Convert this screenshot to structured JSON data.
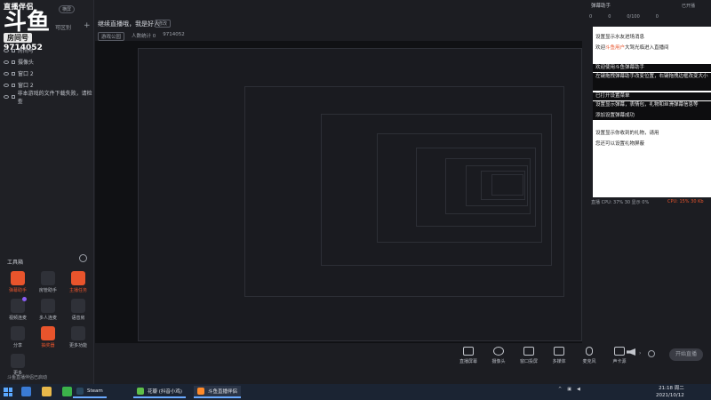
{
  "logo": {
    "line1": "直播伴侣",
    "line2": "斗鱼",
    "badge": "房间号",
    "room_id": "9714052"
  },
  "left": {
    "scene_label": "可区别",
    "add_label": "+",
    "sources": [
      {
        "label": "房间号"
      },
      {
        "label": "摄像头"
      },
      {
        "label": "窗口 2"
      },
      {
        "label": "窗口 2"
      },
      {
        "label": "非本游戏的文件下载失败，请检查"
      }
    ],
    "toolbox_title": "工具箱",
    "tools": [
      {
        "label": "弹幕助手",
        "red": true
      },
      {
        "label": "房管助手",
        "red": false
      },
      {
        "label": "主播任务",
        "red": true
      },
      {
        "label": "视频连麦",
        "red": false
      },
      {
        "label": "多人连麦",
        "red": false
      },
      {
        "label": "语音房",
        "red": false
      },
      {
        "label": "分享",
        "red": false
      },
      {
        "label": "抽奖器",
        "red": true
      },
      {
        "label": "更多功能",
        "red": false
      },
      {
        "label": "更多",
        "red": false
      }
    ]
  },
  "header": {
    "mode": "横屏",
    "announcement": "继续直播哦，我是好人",
    "edit": "修改",
    "category": "游戏公园",
    "fans": "人数统计 0",
    "room": "9714052"
  },
  "bottombar": {
    "items": [
      {
        "label": "直播屏幕"
      },
      {
        "label": "摄像头"
      },
      {
        "label": "窗口投屏"
      },
      {
        "label": "多媒体"
      },
      {
        "label": "麦克风"
      },
      {
        "label": "声卡源"
      }
    ],
    "live_button": "开始直播"
  },
  "right": {
    "title": "弹幕助手",
    "corner": "已开播",
    "stats": [
      "0",
      "0",
      "0/100",
      "0"
    ],
    "messages": [
      {
        "text": "设置显示水友进场消息",
        "dark": false
      },
      {
        "text": "欢迎",
        "red": "斗鱼用户",
        "rest": "大驾光临进入直播间",
        "dark": false
      },
      {
        "text": "欢迎使用斗鱼弹幕助手",
        "dark": true
      },
      {
        "text": "左键拖拽弹幕助手改变位置，右键拖拽边框改变大小",
        "dark": true
      },
      {
        "text": "已打开设置菜单",
        "dark": true
      },
      {
        "text": "设置显示弹幕，表情包，礼物和丝滑弹幕信息等",
        "dark": true
      },
      {
        "text": "添加设置弹幕成功",
        "dark": true
      },
      {
        "text": "设置显示你收到的礼物，请用",
        "dark": false
      },
      {
        "text": "您还可以设置礼物屏蔽",
        "dark": false
      }
    ],
    "footer_stats": "直播 CPU: 37% 30 显示 0%",
    "footer_cpu": "CPU: 15% 30 Kb"
  },
  "taskbar": {
    "apps": [
      {
        "label": "Steam",
        "color": "#2a475e"
      },
      {
        "label": "花瓣 (抖音小鸡)",
        "color": "#5fbf4a"
      },
      {
        "label": "斗鱼直播伴侣",
        "color": "#ff8a2a"
      }
    ],
    "clock_time": "21:18 周二",
    "clock_date": "2021/10/12",
    "status_line": "斗鱼直播伴侣已启动"
  },
  "colors": {
    "accent": "#e8542c",
    "bg": "#1c1d22",
    "preview": "#101114"
  }
}
